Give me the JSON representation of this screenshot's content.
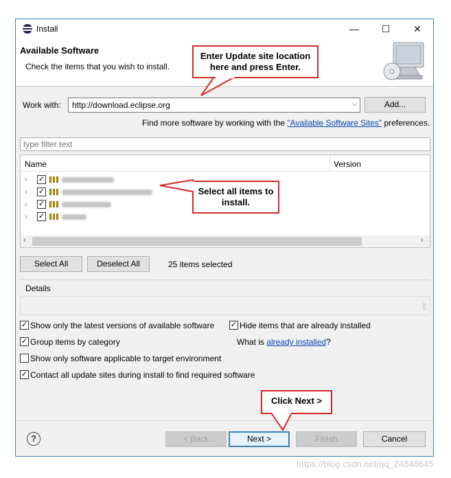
{
  "window": {
    "title": "Install",
    "controls": [
      "—",
      "☐",
      "✕"
    ]
  },
  "header": {
    "title": "Available Software",
    "subtitle": "Check the items that you wish to install.",
    "icon": "monitor-cd-icon"
  },
  "work_with": {
    "label": "Work with:",
    "value": "http://download.eclipse.org",
    "add_label": "Add..."
  },
  "find_more": {
    "prefix": "Find more software by working with the ",
    "link": "\"Available Software Sites\"",
    "suffix": " preferences."
  },
  "filter": {
    "placeholder": "type filter text"
  },
  "tree": {
    "columns": [
      "Name",
      "Version"
    ],
    "rows": [
      {
        "checked": true
      },
      {
        "checked": true
      },
      {
        "checked": true
      },
      {
        "checked": true
      }
    ]
  },
  "selection": {
    "select_all": "Select All",
    "deselect_all": "Deselect All",
    "status": "25 items selected"
  },
  "details": {
    "label": "Details"
  },
  "options": {
    "latest_versions": {
      "label": "Show only the latest versions of available software",
      "checked": true
    },
    "hide_installed": {
      "label": "Hide items that are already installed",
      "checked": true
    },
    "group_by_category": {
      "label": "Group items by category",
      "checked": true
    },
    "what_is_prefix": "What is ",
    "what_is_link": "already installed",
    "what_is_suffix": "?",
    "applicable_only": {
      "label": "Show only software applicable to target environment",
      "checked": false
    },
    "contact_sites": {
      "label": "Contact all update sites during install to find required software",
      "checked": true
    }
  },
  "footer": {
    "back": "< Back",
    "next": "Next >",
    "finish": "Finish",
    "cancel": "Cancel",
    "help": "?"
  },
  "callouts": {
    "update_site": "Enter Update site location here and press Enter.",
    "select_all": "Select all items to install.",
    "next": "Click Next >"
  },
  "watermark": "https://blog.csdn.net/qq_24846645",
  "colors": {
    "callout_border": "#d32626",
    "link": "#0645ad",
    "default_button_border": "#3c7fb1"
  }
}
